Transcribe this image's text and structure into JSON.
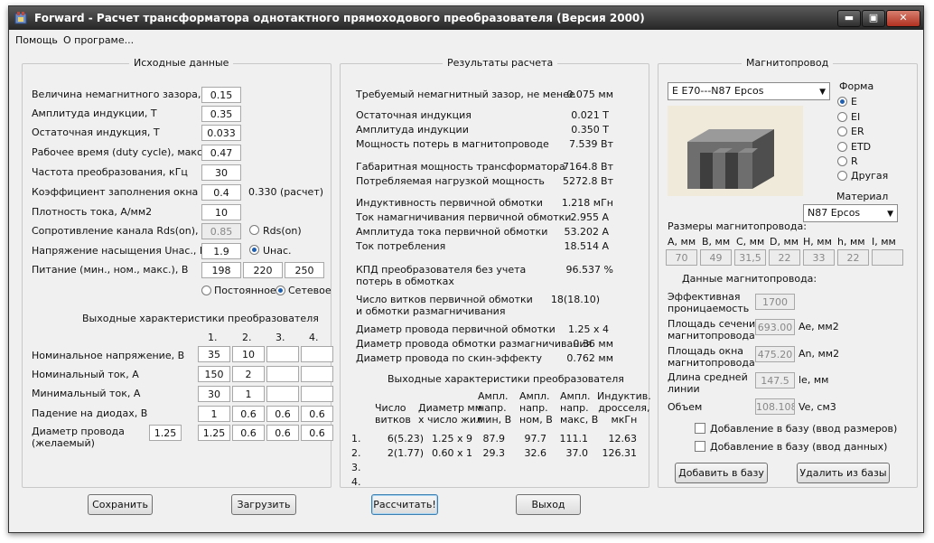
{
  "window": {
    "title": "Forward - Расчет трансформатора однотактного прямоходового преобразователя (Версия 2000)",
    "btn_min": "▬",
    "btn_max": "▣",
    "btn_close": "✕"
  },
  "menu": {
    "help": "Помощь",
    "about": "О програме..."
  },
  "inputs": {
    "group_title": "Исходные данные",
    "gap_label": "Величина немагнитного зазора, мм",
    "gap_value": "0.15",
    "ampind_label": "Амплитуда индукции, Т",
    "ampind_value": "0.35",
    "resind_label": "Остаточная индукция, Т",
    "resind_value": "0.033",
    "duty_label": "Рабочее время (duty cycle), макс.",
    "duty_value": "0.47",
    "freq_label": "Частота преобразования, кГц",
    "freq_value": "30",
    "fill_label": "Коэффициент заполнения окна",
    "fill_value": "0.4",
    "fill_calc": "0.330 (расчет)",
    "curdens_label": "Плотность тока, А/мм2",
    "curdens_value": "10",
    "rds_label": "Сопротивление канала Rds(on), Ом",
    "rds_value": "0.85",
    "rds_radio": "Rds(on)",
    "unas_label": "Напряжение насыщения Uнас., В",
    "unas_value": "1.9",
    "unas_radio": "Uнас.",
    "supply_label": "Питание (мин., ном., макс.), В",
    "supply_min": "198",
    "supply_nom": "220",
    "supply_max": "250",
    "radio_dc": "Постоянное",
    "radio_ac": "Сетевое"
  },
  "outputs_table": {
    "title": "Выходные характеристики преобразователя",
    "cols": [
      "1.",
      "2.",
      "3.",
      "4."
    ],
    "rows": [
      {
        "label": "Номинальное напряжение, В",
        "cells": [
          "35",
          "10",
          "",
          ""
        ]
      },
      {
        "label": "Номинальный ток, А",
        "cells": [
          "150",
          "2",
          "",
          ""
        ]
      },
      {
        "label": "Минимальный ток, А",
        "cells": [
          "30",
          "1",
          "",
          ""
        ]
      },
      {
        "label": "Падение на диодах, В",
        "cells": [
          "1",
          "0.6",
          "0.6",
          "0.6"
        ]
      },
      {
        "label": "Диаметр провода\n(желаемый)",
        "desired": "1.25",
        "cells": [
          "1.25",
          "0.6",
          "0.6",
          "0.6"
        ]
      }
    ]
  },
  "results": {
    "group_title": "Результаты расчета",
    "items": [
      {
        "label": "Требуемый немагнитный зазор, не менее",
        "value": "0.075 мм"
      },
      {
        "label": "Остаточная индукция",
        "value": "0.021 Т"
      },
      {
        "label": "Амплитуда индукции",
        "value": "0.350 Т"
      },
      {
        "label": "Мощность потерь в магнитопроводе",
        "value": "7.539 Вт"
      },
      {
        "label": "Габаритная мощность трансформатора",
        "value": "7164.8 Вт"
      },
      {
        "label": "Потребляемая нагрузкой мощность",
        "value": "5272.8 Вт"
      },
      {
        "label": "Индуктивность первичной обмотки",
        "value": "1.218 мГн"
      },
      {
        "label": "Ток намагничивания первичной обмотки",
        "value": "2.955 А"
      },
      {
        "label": "Амплитуда тока первичной обмотки",
        "value": "53.202 А"
      },
      {
        "label": "Ток потребления",
        "value": "18.514 А"
      },
      {
        "label": "КПД преобразователя без учета\nпотерь в обмотках",
        "value": "96.537 %"
      },
      {
        "label": "Число витков первичной обмотки\nи обмотки размагничивания",
        "value": "18(18.10)"
      },
      {
        "label": "Диаметр провода первичной обмотки",
        "value": "1.25 x 4"
      },
      {
        "label": "Диаметр провода обмотки размагничивания",
        "value": "0.36 мм"
      },
      {
        "label": "Диаметр провода по скин-эффекту",
        "value": "0.762 мм"
      }
    ],
    "out_title": "Выходные характеристики преобразователя",
    "out_headers": [
      "Число\nвитков",
      "Диаметр мм\nх число жил",
      "Ампл.\nнапр.\nмин, В",
      "Ампл.\nнапр.\nном, В",
      "Ампл.\nнапр.\nмакс, В",
      "Индуктив.\nдросселя,\nмкГн"
    ],
    "out_rows": [
      {
        "num": "1.",
        "cells": [
          "6(5.23)",
          "1.25 x 9",
          "87.9",
          "97.7",
          "111.1",
          "12.63"
        ]
      },
      {
        "num": "2.",
        "cells": [
          "2(1.77)",
          "0.60 x 1",
          "29.3",
          "32.6",
          "37.0",
          "126.31"
        ]
      },
      {
        "num": "3.",
        "cells": [
          "",
          "",
          "",
          "",
          "",
          ""
        ]
      },
      {
        "num": "4.",
        "cells": [
          "",
          "",
          "",
          "",
          "",
          ""
        ]
      }
    ]
  },
  "core": {
    "group_title": "Магнитопровод",
    "core_select": "E E70---N87 Epcos",
    "shape_title": "Форма",
    "shapes": [
      "E",
      "EI",
      "ER",
      "ETD",
      "R",
      "Другая"
    ],
    "shape_selected": "E",
    "material_title": "Материал",
    "material_select": "N87 Epcos",
    "dims_title": "Размеры магнитопровода:",
    "dims_labels": [
      "A, мм",
      "B, мм",
      "C, мм",
      "D, мм",
      "H, мм",
      "h, мм",
      "I, мм"
    ],
    "dims_values": [
      "70",
      "49",
      "31,5",
      "22",
      "33",
      "22",
      ""
    ],
    "data_title": "Данные магнитопровода:",
    "permeability_label": "Эффективная\nпроницаемость",
    "permeability_value": "1700",
    "area_label": "Площадь сечения\nмагнитопровода",
    "area_value": "693.00",
    "area_unit": "Ae, мм2",
    "window_label": "Площадь окна\nмагнитопровода",
    "window_value": "475.20",
    "window_unit": "An, мм2",
    "length_label": "Длина средней\nлинии",
    "length_value": "147.5",
    "length_unit": "le, мм",
    "volume_label": "Объем",
    "volume_value": "108.108",
    "volume_unit": "Ve, см3",
    "chk_dims": "Добавление в базу (ввод размеров)",
    "chk_data": "Добавление в базу (ввод данных)",
    "btn_add": "Добавить в базу",
    "btn_remove": "Удалить из базы"
  },
  "bottom": {
    "save": "Сохранить",
    "load": "Загрузить",
    "calc": "Рассчитать!",
    "exit": "Выход"
  },
  "colors": {
    "window_bg": "#f0f0f0",
    "titlebar": "#2e2e2e",
    "radio_accent": "#1f5fb0"
  }
}
